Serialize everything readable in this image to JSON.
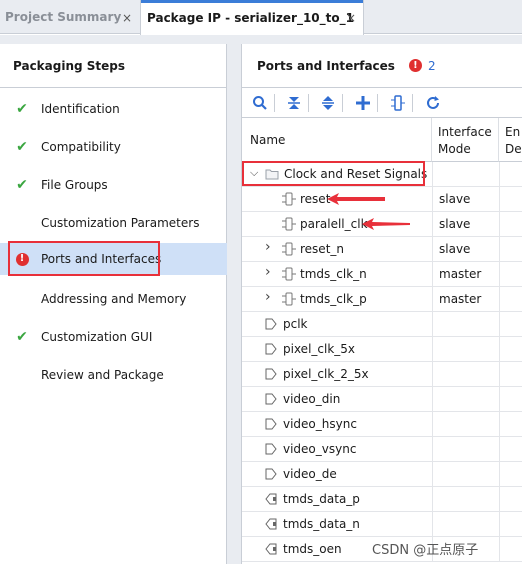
{
  "tabs": [
    {
      "label": "Project Summary",
      "close": "×"
    },
    {
      "label": "Package IP - serializer_10_to_1",
      "close": "×"
    }
  ],
  "left_panel": {
    "title": "Packaging Steps",
    "steps": [
      {
        "label": "Identification",
        "status": "complete"
      },
      {
        "label": "Compatibility",
        "status": "complete"
      },
      {
        "label": "File Groups",
        "status": "complete"
      },
      {
        "label": "Customization Parameters",
        "status": "none"
      },
      {
        "label": "Ports and Interfaces",
        "status": "error"
      },
      {
        "label": "Addressing and Memory",
        "status": "none"
      },
      {
        "label": "Customization GUI",
        "status": "complete"
      },
      {
        "label": "Review and Package",
        "status": "none"
      }
    ]
  },
  "right_panel": {
    "title": "Ports and Interfaces",
    "error_count": "2",
    "toolbar_icons": [
      "search-icon",
      "collapse-all-icon",
      "expand-all-icon",
      "add-icon",
      "interface-icon",
      "refresh-icon"
    ],
    "columns": {
      "name": "Name",
      "mode_line1": "Interface",
      "mode_line2": "Mode",
      "enable_line1": "En",
      "enable_line2": "De"
    },
    "rows": [
      {
        "name": "Clock and Reset Signals",
        "mode": "",
        "kind": "folder",
        "expander": "open"
      },
      {
        "name": "reset",
        "mode": "slave",
        "kind": "interface",
        "expander": "none"
      },
      {
        "name": "paralell_clk",
        "mode": "slave",
        "kind": "interface",
        "expander": "none"
      },
      {
        "name": "reset_n",
        "mode": "slave",
        "kind": "interface",
        "expander": "closed"
      },
      {
        "name": "tmds_clk_n",
        "mode": "master",
        "kind": "interface",
        "expander": "closed"
      },
      {
        "name": "tmds_clk_p",
        "mode": "master",
        "kind": "interface",
        "expander": "closed"
      },
      {
        "name": "pclk",
        "mode": "",
        "kind": "in-port",
        "expander": "none"
      },
      {
        "name": "pixel_clk_5x",
        "mode": "",
        "kind": "in-port",
        "expander": "none"
      },
      {
        "name": "pixel_clk_2_5x",
        "mode": "",
        "kind": "in-port",
        "expander": "none"
      },
      {
        "name": "video_din",
        "mode": "",
        "kind": "in-port",
        "expander": "none"
      },
      {
        "name": "video_hsync",
        "mode": "",
        "kind": "in-port",
        "expander": "none"
      },
      {
        "name": "video_vsync",
        "mode": "",
        "kind": "in-port",
        "expander": "none"
      },
      {
        "name": "video_de",
        "mode": "",
        "kind": "in-port",
        "expander": "none"
      },
      {
        "name": "tmds_data_p",
        "mode": "",
        "kind": "out-port",
        "expander": "none"
      },
      {
        "name": "tmds_data_n",
        "mode": "",
        "kind": "out-port",
        "expander": "none"
      },
      {
        "name": "tmds_oen",
        "mode": "",
        "kind": "out-port",
        "expander": "none"
      }
    ]
  },
  "watermark": "CSDN @正点原子",
  "colors": {
    "accent": "#2f6cd1",
    "check": "#3aa640",
    "error": "#e03030",
    "annotation": "#e8303a",
    "selected": "#cfe0f7"
  }
}
